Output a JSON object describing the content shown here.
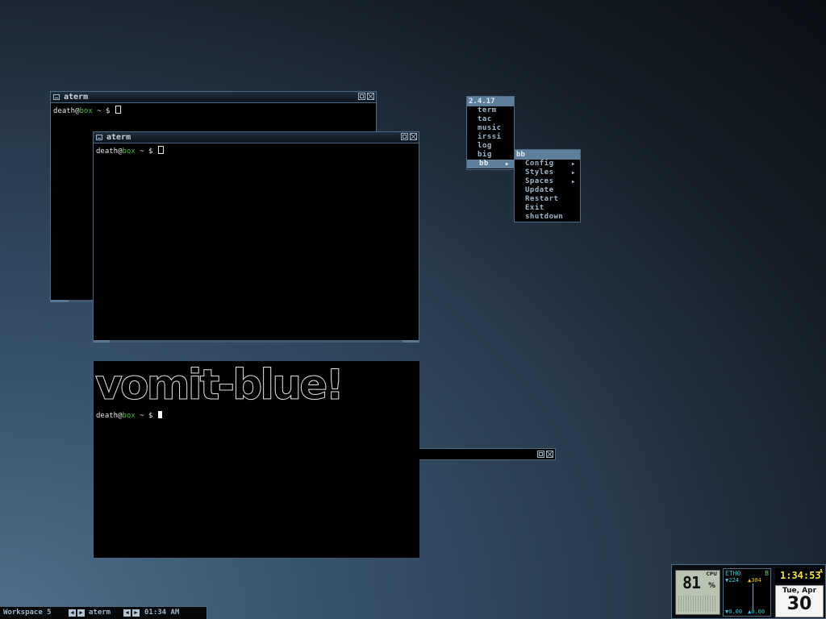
{
  "windows": {
    "aterm_back": {
      "title": "aterm",
      "prompt_user": "death",
      "prompt_at": "@",
      "prompt_host": "box",
      "prompt_rest": " ~ $ "
    },
    "aterm_front": {
      "title": "aterm",
      "prompt_user": "death",
      "prompt_at": "@",
      "prompt_host": "box",
      "prompt_rest": " ~ $ "
    },
    "aterm_banner": {
      "banner": "vomit-blue!",
      "prompt_user": "death",
      "prompt_at": "@",
      "prompt_host": "box",
      "prompt_rest": " ~ $ "
    }
  },
  "root_menu": {
    "title": "2.4.17",
    "items": [
      {
        "label": "term"
      },
      {
        "label": "tac"
      },
      {
        "label": "music"
      },
      {
        "label": "irssi"
      },
      {
        "label": "log"
      },
      {
        "label": "big"
      },
      {
        "label": "bb",
        "submenu": true
      }
    ]
  },
  "bb_menu": {
    "title": "bb",
    "items": [
      {
        "label": "Config",
        "submenu": true
      },
      {
        "label": "Styles",
        "submenu": true
      },
      {
        "label": "Spaces",
        "submenu": true
      },
      {
        "label": "Update"
      },
      {
        "label": "Restart"
      },
      {
        "label": "Exit"
      },
      {
        "label": "shutdown"
      }
    ]
  },
  "toolbar": {
    "workspace": "Workspace 5",
    "window": "aterm",
    "time": "01:34 AM"
  },
  "slit": {
    "cpu_value": "81",
    "cpu_unit": "%",
    "cpu_label": "CPU",
    "net_iface": "ETH0",
    "net_flag": "B",
    "net_down_top": "▼224",
    "net_up_top": "▲304",
    "net_down_bottom": "▼0.00",
    "net_up_bottom": "▲0.00",
    "clock": "1:34:53",
    "clock_ampm": "A",
    "date_line": "Tue, Apr",
    "date_day": "30"
  },
  "colors": {
    "accent": "#5e7f9c",
    "host_green": "#4cbf40",
    "clock_yellow": "#f0e04a"
  }
}
